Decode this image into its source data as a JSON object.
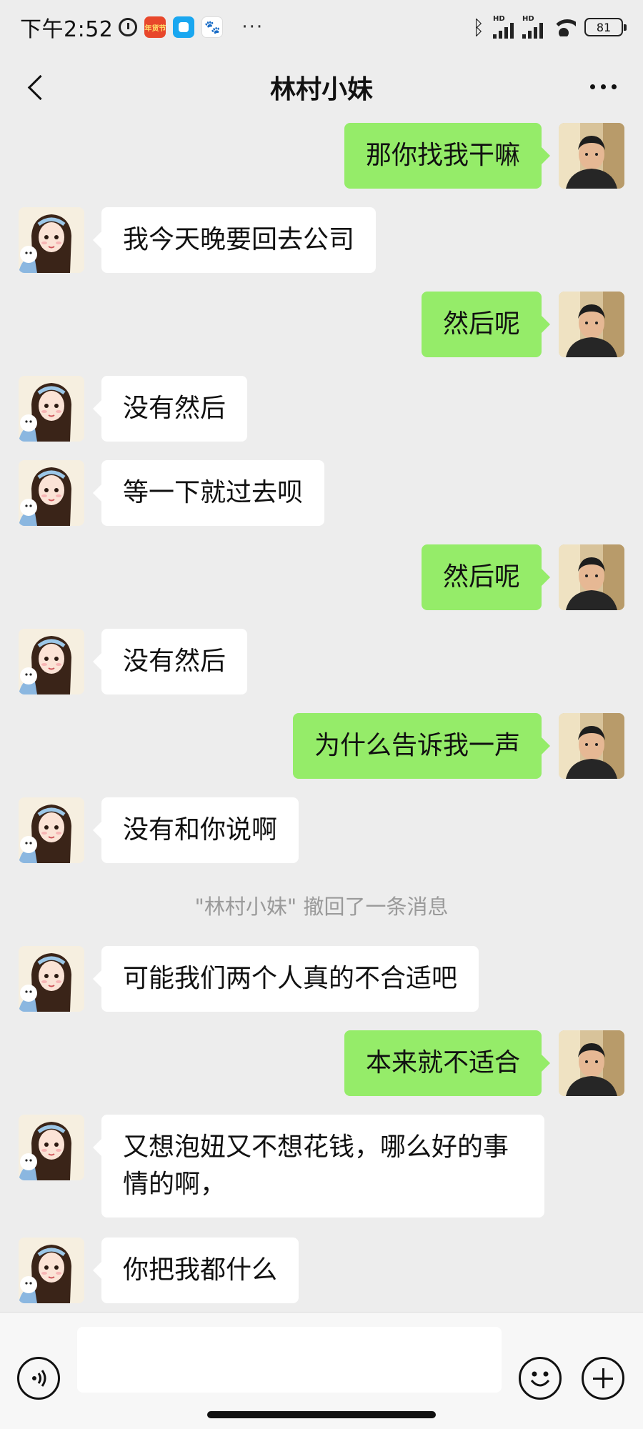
{
  "status_bar": {
    "time": "下午2:52",
    "app_badge": "年货节",
    "battery": "81",
    "hd1": "HD",
    "hd2": "HD"
  },
  "header": {
    "title": "林村小妹",
    "back_icon": "chevron-left-icon",
    "menu_icon": "more-dots-icon"
  },
  "messages": [
    {
      "side": "right",
      "text": "那你找我干嘛"
    },
    {
      "side": "left",
      "text": "我今天晚要回去公司"
    },
    {
      "side": "right",
      "text": "然后呢"
    },
    {
      "side": "left",
      "text": "没有然后"
    },
    {
      "side": "left",
      "text": "等一下就过去呗"
    },
    {
      "side": "right",
      "text": "然后呢"
    },
    {
      "side": "left",
      "text": "没有然后"
    },
    {
      "side": "right",
      "text": "为什么告诉我一声"
    },
    {
      "side": "left",
      "text": "没有和你说啊"
    },
    {
      "side": "left",
      "text": "可能我们两个人真的不合适吧"
    },
    {
      "side": "right",
      "text": "本来就不适合"
    },
    {
      "side": "left",
      "text": "又想泡妞又不想花钱，哪么好的事情的啊，"
    },
    {
      "side": "left",
      "text": "你把我都什么"
    }
  ],
  "system_note": "\"林村小妹\" 撤回了一条消息",
  "input_bar": {
    "value": "",
    "voice_icon": "voice-icon",
    "emoji_icon": "emoji-icon",
    "plus_icon": "plus-icon"
  },
  "colors": {
    "background": "#ededed",
    "sent_bubble": "#95ec69",
    "received_bubble": "#ffffff"
  }
}
